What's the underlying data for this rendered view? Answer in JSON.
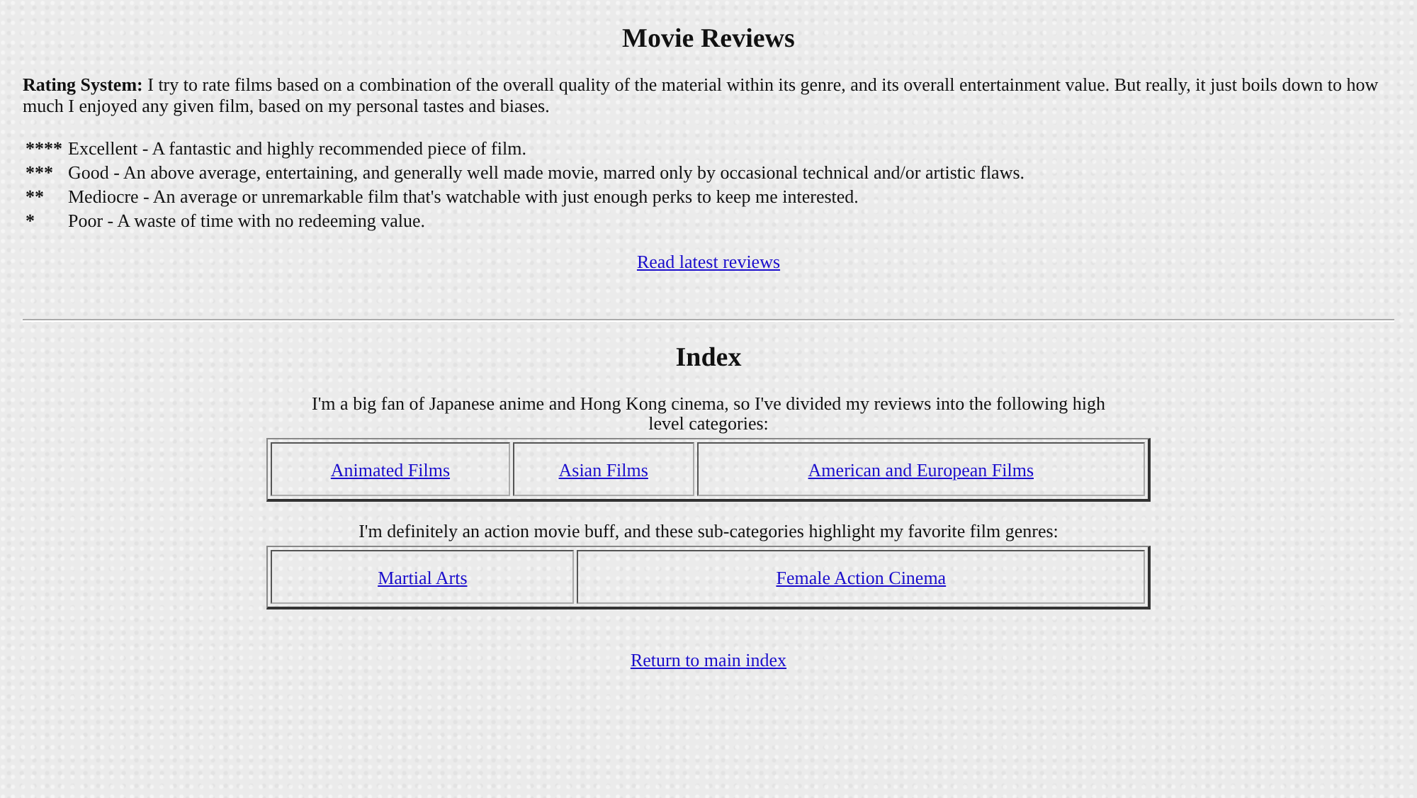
{
  "title": "Movie Reviews",
  "rating_system": {
    "text": "**Rating System:** I try to rate films based on a combination of the overall quality of the material within its genre, and its overall entertainment value. But really, it just boils down to how much I enjoyed any given film, based on my personal tastes and biases."
  },
  "ratings": [
    {
      "stars_text": "****",
      "description": "Excellent - A fantastic and highly recommended piece of film."
    },
    {
      "stars_text": "***",
      "description": "Good - An above average, entertaining, and generally well made movie, marred only by occasional technical and/or artistic flaws."
    },
    {
      "stars_text": "**",
      "description": "Mediocre - An average or unremarkable film that's watchable with just enough perks to keep me interested."
    },
    {
      "stars_text": "*",
      "description": "Poor - A waste of time with no redeeming value."
    }
  ],
  "latest_link": "Read latest reviews",
  "index": {
    "heading": "Index",
    "sections": [
      {
        "intro": "I'm a big fan of Japanese anime and Hong Kong cinema, so I've divided my reviews into the following high level categories:",
        "links": [
          "Animated Films",
          "Asian Films",
          "American and European Films"
        ]
      },
      {
        "intro": "I'm definitely an action movie buff, and these sub-categories highlight my favorite film genres:",
        "links": [
          "Martial Arts",
          "Female Action Cinema"
        ]
      }
    ]
  },
  "return_link": "Return to main index"
}
